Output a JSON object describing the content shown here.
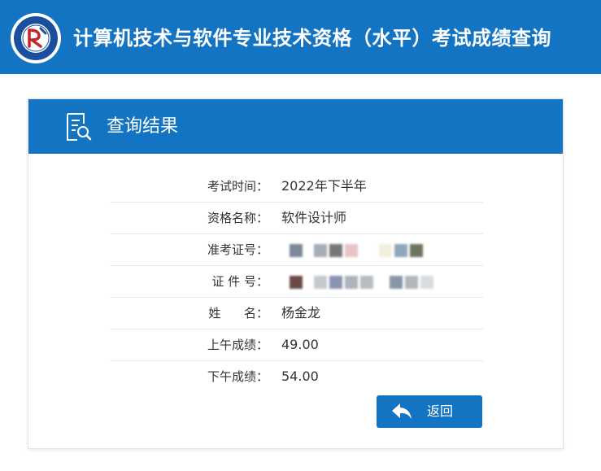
{
  "header": {
    "title": "计算机技术与软件专业技术资格（水平）考试成绩查询",
    "logo_icon": "ruankao-seal-icon",
    "background_color": "#1474c4"
  },
  "card": {
    "title": "查询结果",
    "title_icon": "search-document-icon",
    "rows": [
      {
        "label": "考试时间：",
        "value": "2022年下半年",
        "redacted": false
      },
      {
        "label": "资格名称：",
        "value": "软件设计师",
        "redacted": false
      },
      {
        "label": "准考证号：",
        "value": "",
        "redacted": true
      },
      {
        "label": "证 件 号：",
        "value": "",
        "redacted": true
      },
      {
        "label": "姓      名：",
        "value": "杨金龙",
        "redacted": false
      },
      {
        "label": "上午成绩：",
        "value": "49.00",
        "redacted": false
      },
      {
        "label": "下午成绩：",
        "value": "54.00",
        "redacted": false
      }
    ]
  },
  "back_button": {
    "label": "返回",
    "icon": "reply-arrow-icon"
  }
}
